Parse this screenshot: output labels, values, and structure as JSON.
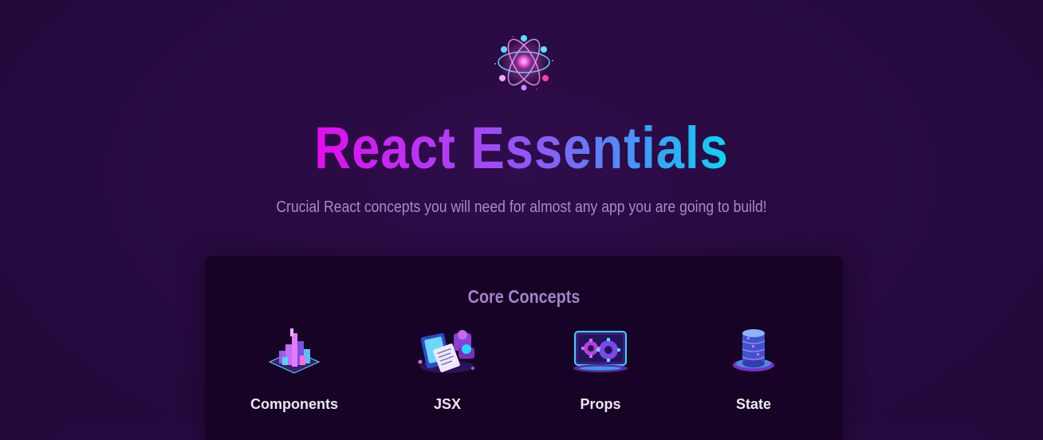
{
  "header": {
    "logo_icon": "react-atom-icon",
    "title": "React Essentials",
    "subtitle": "Crucial React concepts you will need for almost any app you are going to build!"
  },
  "core_concepts": {
    "heading": "Core Concepts",
    "items": [
      {
        "label": "Components",
        "icon": "components-icon"
      },
      {
        "label": "JSX",
        "icon": "jsx-icon"
      },
      {
        "label": "Props",
        "icon": "props-icon"
      },
      {
        "label": "State",
        "icon": "state-icon"
      }
    ]
  },
  "colors": {
    "background": "#280a40",
    "panel": "#160326",
    "title_gradient_start": "#e30cf0",
    "title_gradient_end": "#0ad7f3",
    "subtitle": "#a98ac7",
    "concept_label": "#ece6f3"
  }
}
